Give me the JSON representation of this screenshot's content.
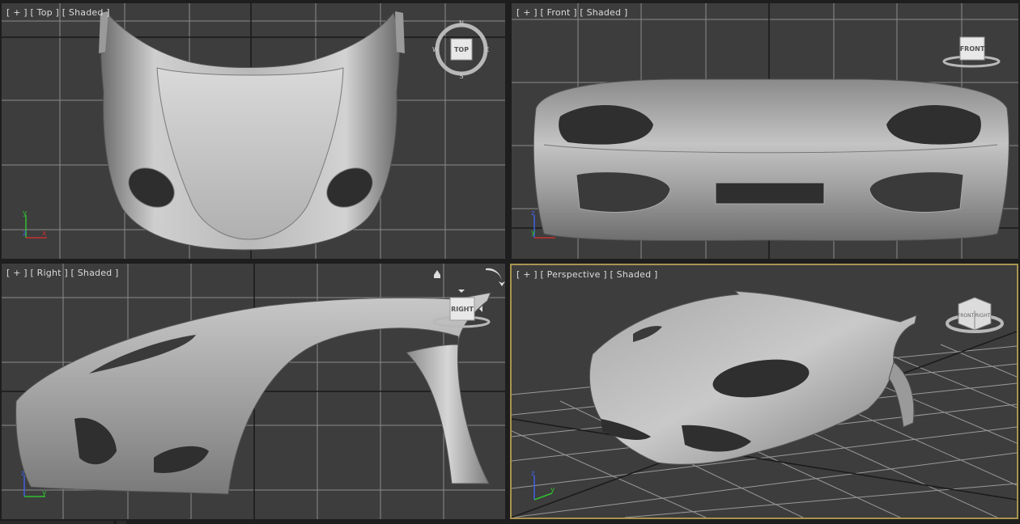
{
  "viewports": {
    "top": {
      "label": "[ + ] [ Top ] [ Shaded ]",
      "cube": "TOP"
    },
    "front": {
      "label": "[ + ] [ Front ] [ Shaded ]",
      "cube": "FRONT"
    },
    "right": {
      "label": "[ + ] [ Right ] [ Shaded ]",
      "cube": "RIGHT"
    },
    "persp": {
      "label": "[ + ] [ Perspective ] [ Shaded ]",
      "cube_left": "FRONT",
      "cube_right": "RIGHT"
    }
  },
  "compass": {
    "n": "N",
    "s": "S",
    "e": "E",
    "w": "W"
  },
  "axes": {
    "x": "x",
    "y": "y",
    "z": "z"
  },
  "colors": {
    "viewport_bg": "#3d3d3d",
    "grid": "#8a8a8a",
    "active_border": "#a89450",
    "axis_x": "#c83030",
    "axis_y": "#30c030",
    "axis_z": "#4060e0"
  }
}
